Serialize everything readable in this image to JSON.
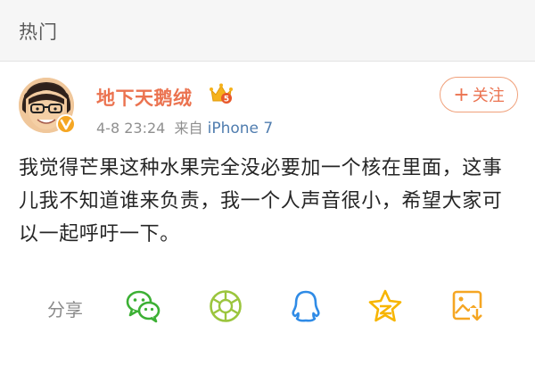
{
  "header": {
    "title": "热门"
  },
  "post": {
    "username": "地下天鹅绒",
    "date": "4-8 23:24",
    "source_prefix": "来自",
    "device": "iPhone 7",
    "follow_label": "关注",
    "follow_plus": "+",
    "text": "我觉得芒果这种水果完全没必要加一个核在里面，这事儿我不知道谁来负责，我一个人声音很小，希望大家可以一起呼吁一下。"
  },
  "share": {
    "label": "分享",
    "targets": [
      "wechat-icon",
      "moments-icon",
      "qq-icon",
      "qzone-icon",
      "save-image-icon"
    ]
  },
  "colors": {
    "accent": "#eb7350",
    "link": "#507daf",
    "wechat": "#3cb034",
    "moments": "#9bc53d",
    "qq": "#2f8be6",
    "qzone": "#f7b500",
    "save": "#f5a623"
  }
}
